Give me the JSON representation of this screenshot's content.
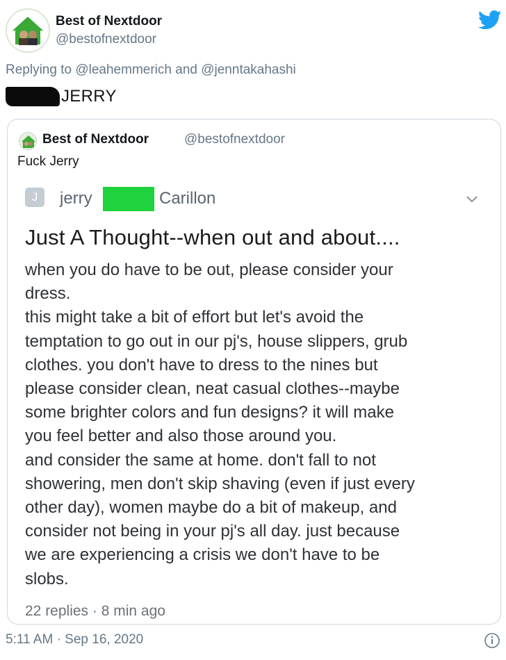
{
  "tweet": {
    "author_name": "Best of Nextdoor",
    "author_handle": "@bestofnextdoor",
    "replying_prefix": "Replying to",
    "replying_to": [
      "@leahemmerich",
      "@jenntakahashi"
    ],
    "replying_joiner": "and",
    "text": "JERRY",
    "timestamp": "5:11 AM · Sep 16, 2020"
  },
  "quote": {
    "author_name": "Best of Nextdoor",
    "author_handle": "@bestofnextdoor",
    "text": "Fuck Jerry"
  },
  "nextdoor": {
    "avatar_letter": "J",
    "first_name": "jerry",
    "last_name": "Carillon",
    "title": "Just A Thought--when out and about....",
    "body_lines": [
      "when you do have to be out, please consider your",
      "dress.",
      "this might take a bit of effort but let's avoid the",
      "temptation to go out in our pj's, house slippers, grub",
      "clothes.  you don't have to dress to the nines but",
      "please consider clean, neat casual clothes--maybe",
      "some brighter colors and fun designs?  it will make",
      "you feel better and also those around you.",
      "and consider the same at home.  don't fall to not",
      "showering, men don't skip shaving (even if just every",
      "other day), women maybe do a bit of makeup, and",
      "consider not being in your pj's all day. just because",
      "we are experiencing a crisis we don't have to be",
      "slobs."
    ],
    "meta": "22 replies · 8 min ago"
  },
  "colors": {
    "twitter_blue": "#1da1f2",
    "redaction_green": "#20d23d",
    "secondary_text": "#657786"
  },
  "icons": [
    "twitter-bird-icon",
    "chevron-down-icon",
    "info-icon"
  ]
}
